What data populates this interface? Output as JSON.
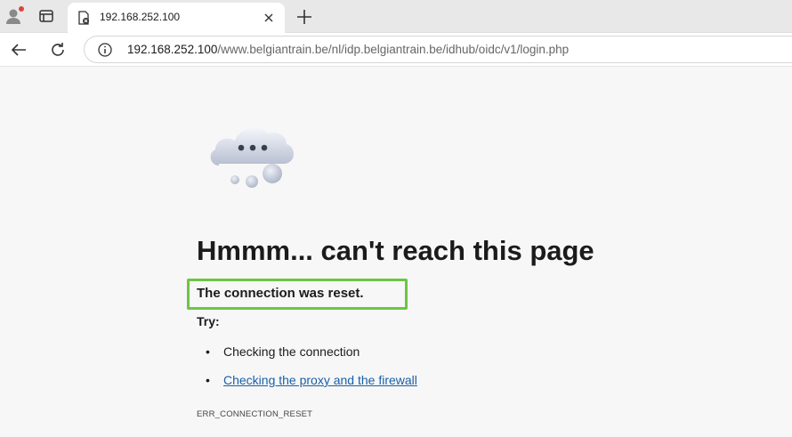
{
  "tab": {
    "title": "192.168.252.100"
  },
  "address": {
    "host": "192.168.252.100",
    "path": "/www.belgiantrain.be/nl/idp.belgiantrain.be/idhub/oidc/v1/login.php"
  },
  "error": {
    "headline": "Hmmm... can't reach this page",
    "detail": "The connection was reset.",
    "try_label": "Try:",
    "suggestions": [
      "Checking the connection",
      "Checking the proxy and the firewall"
    ],
    "bullet": "•",
    "code": "ERR_CONNECTION_RESET"
  },
  "colors": {
    "highlight": "#6cc644",
    "link": "#1a5fa8"
  }
}
